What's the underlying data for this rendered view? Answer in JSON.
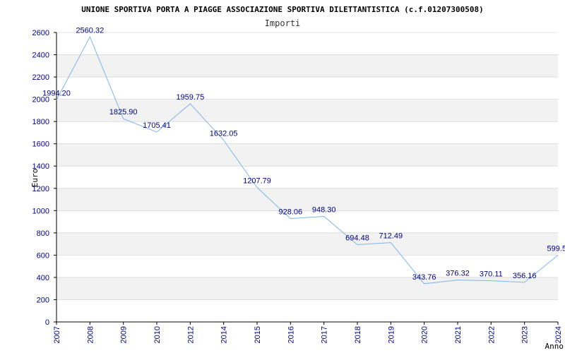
{
  "chart_data": {
    "type": "line",
    "title": "UNIONE SPORTIVA PORTA A PIAGGE ASSOCIAZIONE SPORTIVA DILETTANTISTICA (c.f.01207300508)",
    "subtitle": "Importi",
    "xlabel": "Anno",
    "ylabel": "Euro",
    "ylim": [
      0,
      2600
    ],
    "yticks": [
      "0",
      "200",
      "400",
      "600",
      "800",
      "1000",
      "1200",
      "1400",
      "1600",
      "1800",
      "2000",
      "2200",
      "2400",
      "2600"
    ],
    "grid": true,
    "colors": {
      "line": "#7cb5ec",
      "band": "#f2f2f2",
      "grid": "#cccccc",
      "ticks": "#00008b"
    },
    "categories": [
      "2007",
      "2008",
      "2009",
      "2010",
      "2012",
      "2014",
      "2015",
      "2016",
      "2017",
      "2018",
      "2019",
      "2020",
      "2021",
      "2022",
      "2023",
      "2024"
    ],
    "values": [
      1994.2,
      2560.32,
      1825.9,
      1705.41,
      1959.75,
      1632.05,
      1207.79,
      928.06,
      948.3,
      694.48,
      712.49,
      343.76,
      376.32,
      370.11,
      356.16,
      599.5
    ],
    "value_labels": [
      "1994.20",
      "2560.32",
      "1825.90",
      "1705.41",
      "1959.75",
      "1632.05",
      "1207.79",
      "928.06",
      "948.30",
      "694.48",
      "712.49",
      "343.76",
      "376.32",
      "370.11",
      "356.16",
      "599.5"
    ]
  }
}
